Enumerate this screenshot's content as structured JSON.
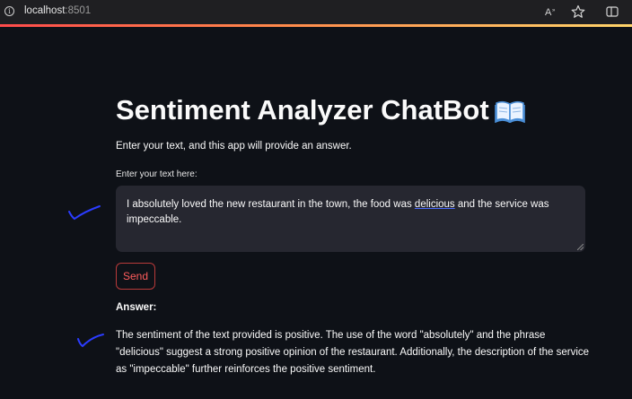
{
  "browser": {
    "host": "localhost",
    "port": ":8501",
    "info_icon": "info-icon",
    "toolbar_icons": [
      "read-aloud-icon",
      "favorite-star-icon",
      "sidebar-icon"
    ]
  },
  "app": {
    "title": "Sentiment Analyzer ChatBot",
    "title_icon": "open-book-emoji",
    "subtitle": "Enter your text, and this app will provide an answer.",
    "input_label": "Enter your text here:",
    "input_value_before": "I absolutely loved the new restaurant in the town, the food was ",
    "input_value_spell": "delicious",
    "input_value_after": " and the service was impeccable.",
    "send_label": "Send",
    "answer_label": "Answer:",
    "answer_text": "The sentiment of the text provided is positive. The use of the word \"absolutely\" and the phrase \"delicious\" suggest a strong positive opinion of the restaurant. Additionally, the description of the service as \"impeccable\" further reinforces the positive sentiment."
  },
  "colors": {
    "background": "#0e1117",
    "input_bg": "#262730",
    "accent": "#ff4b4b",
    "annotation": "#2b3cff"
  }
}
